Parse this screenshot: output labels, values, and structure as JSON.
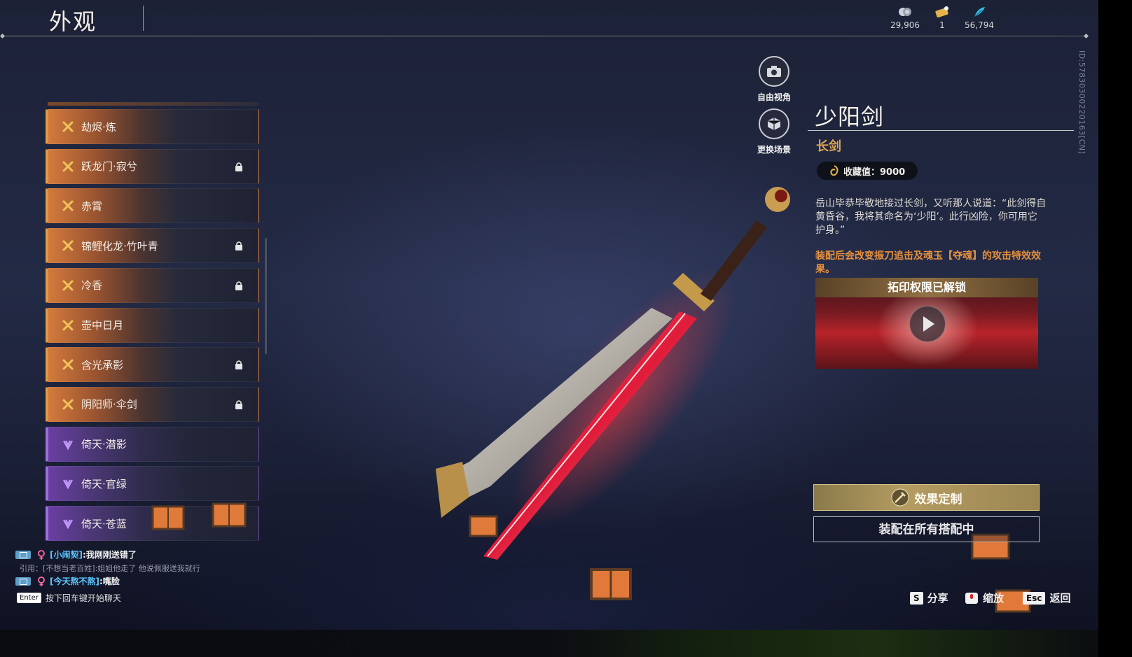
{
  "header": {
    "title": "外观"
  },
  "currencies": [
    {
      "icon": "silver-coin-icon",
      "value": "29,906"
    },
    {
      "icon": "ticket-icon",
      "value": "1"
    },
    {
      "icon": "feather-icon",
      "value": "56,794"
    }
  ],
  "side_id": "ID:5783030022016​3[CN]",
  "list": {
    "items": [
      {
        "label": "劫烬·炼",
        "tier": "gold",
        "locked": false
      },
      {
        "label": "跃龙门·寂兮",
        "tier": "gold",
        "locked": true
      },
      {
        "label": "赤霄",
        "tier": "gold",
        "locked": false
      },
      {
        "label": "锦鲤化龙·竹叶青",
        "tier": "gold",
        "locked": true
      },
      {
        "label": "冷香",
        "tier": "gold",
        "locked": true
      },
      {
        "label": "壶中日月",
        "tier": "gold",
        "locked": false
      },
      {
        "label": "含光承影",
        "tier": "gold",
        "locked": true
      },
      {
        "label": "阴阳师·伞剑",
        "tier": "gold",
        "locked": true
      },
      {
        "label": "倚天·潜影",
        "tier": "purple",
        "locked": false
      },
      {
        "label": "倚天·官绿",
        "tier": "purple",
        "locked": false
      },
      {
        "label": "倚天·苍蓝",
        "tier": "purple",
        "locked": false
      }
    ]
  },
  "camera": {
    "free_view": "自由视角",
    "change_scene": "更换场景"
  },
  "detail": {
    "name": "少阳剑",
    "type": "长剑",
    "collect_value": "收藏值：9000",
    "description": "岳山毕恭毕敬地接过长剑，又听那人说道：“此剑得自黄昏谷，我将其命名为‘少阳’。此行凶险，你可用它护身。”",
    "effect": "装配后会改变振刀追击及魂玉【夺魂】的攻击特效效果。",
    "video_title": "拓印权限已解锁",
    "custom_button": "效果定制",
    "equip_button": "装配在所有搭配中"
  },
  "chat": {
    "line1_name": "[小闹契]",
    "line1_msg": ":我刚刚送错了",
    "line2_quote": "引用：[不想当老百姓]:姐姐他走了 他说佩服送我就行",
    "line3_name": "[今天熬不熬]",
    "line3_msg": ":嘴脸",
    "enter_key": "Enter",
    "hint": "按下回车键开始聊天"
  },
  "hotkeys": {
    "share_key": "S",
    "share": "分享",
    "zoom": "缩放",
    "back_key": "Esc",
    "back": "返回"
  },
  "colors": {
    "gold_accent": "#e09a40",
    "purple_accent": "#9b6fe0",
    "type_color": "#dca454",
    "effect_color": "#e7913c",
    "chat_name": "#5cc6ff"
  }
}
